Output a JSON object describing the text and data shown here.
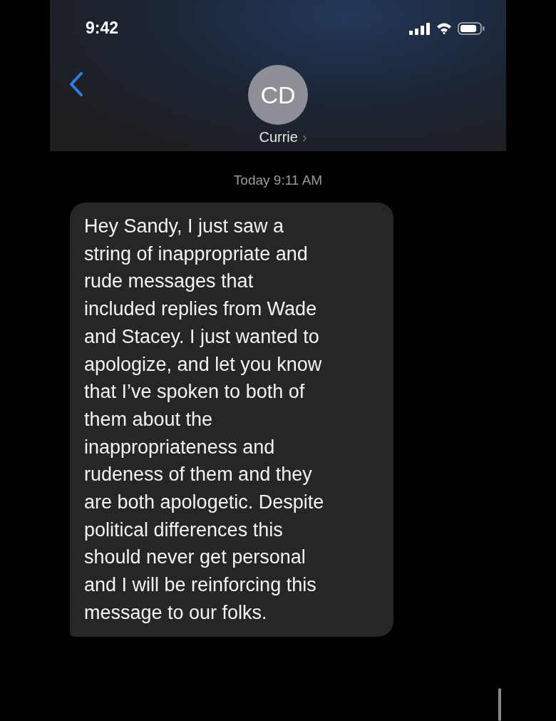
{
  "status_bar": {
    "time": "9:42"
  },
  "header": {
    "avatar_initials": "CD",
    "contact_name": "Currie",
    "chevron": "›"
  },
  "timestamp": "Today 9:11 AM",
  "messages": [
    {
      "kind": "received",
      "text": "Hey Sandy, I just saw a\nstring of inappropriate and\nrude messages that\nincluded replies from Wade\nand Stacey. I just wanted to\napologize, and let you know\nthat I’ve spoken to both of\nthem about the\ninappropriateness and\nrudeness of them and they\nare both apologetic. Despite\npolitical differences this\nshould never get personal\nand I will be reinforcing this\nmessage to our folks."
    }
  ]
}
